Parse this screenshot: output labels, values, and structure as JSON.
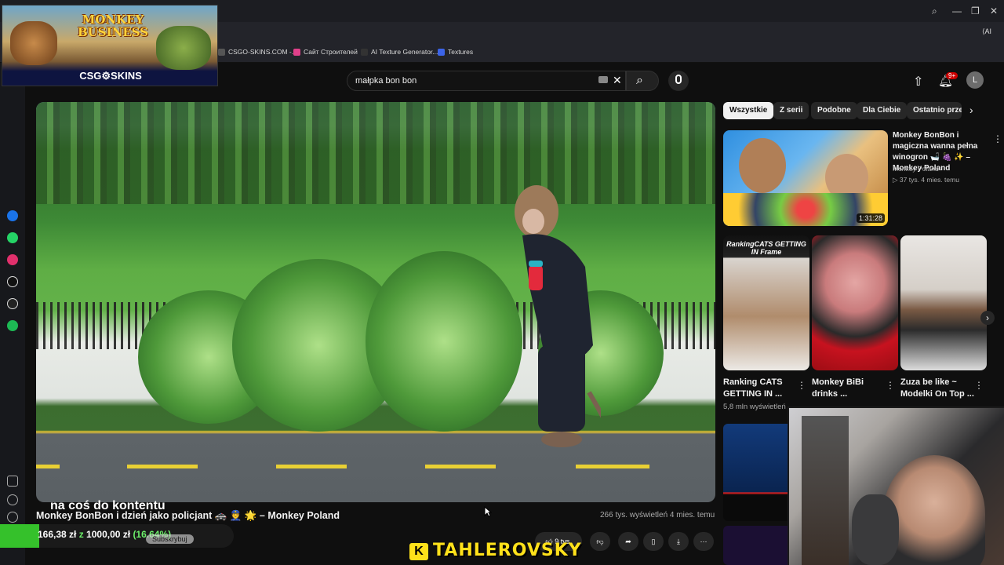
{
  "promo": {
    "title": "MONKEY BUSINESS",
    "brand": "CSG⚙SKINS"
  },
  "bookmarks": [
    "CSGO-SKINS.COM -...",
    "Сайт Строителей",
    "AI Texture Generator...",
    "Textures"
  ],
  "header": {
    "search_value": "małpka bon bon",
    "notification_badge": "9+",
    "avatar_letter": "L"
  },
  "video": {
    "overlay_caption": "na coś do kontentu",
    "title": "Monkey BonBon i dzień jako policjant 🚓 👮 🌟 – Monkey Poland",
    "meta": "266 tys. wyświetleń  4 mies. temu",
    "likes": "9 tys.",
    "subscribe": "Subskrybuj"
  },
  "donation": {
    "current": "166,38 zł",
    "sep": " z ",
    "goal": "1000,00 zł",
    "percent": "(16.64%)",
    "percent_value": 16.64
  },
  "twitch_name": "TAHLEROVSKY",
  "chips": [
    "Wszystkie",
    "Z serii",
    "Podobne",
    "Dla Ciebie",
    "Ostatnio prze"
  ],
  "recommended": {
    "title": "Monkey BonBon i magiczna wanna pełna winogron 🛁 🍇 ✨ – Monkey Poland",
    "channel": "Monkey Poland",
    "views": "▷ 37 tys.  4 mies. temu",
    "duration": "1:31:28"
  },
  "shorts": [
    {
      "title": "Ranking CATS GETTING IN ...",
      "overlay": "RankingCATS GETTING IN Frame"
    },
    {
      "title": "Monkey BiBi drinks ...",
      "overlay": ""
    },
    {
      "title": "Zuza be like ~ Modelki On Top ...",
      "overlay": ""
    }
  ],
  "shorts_views": "5,8 mln wyświetleń",
  "colors": {
    "accent": "#ff0000",
    "donation": "#35c12b",
    "twitch": "#ffe11a"
  }
}
